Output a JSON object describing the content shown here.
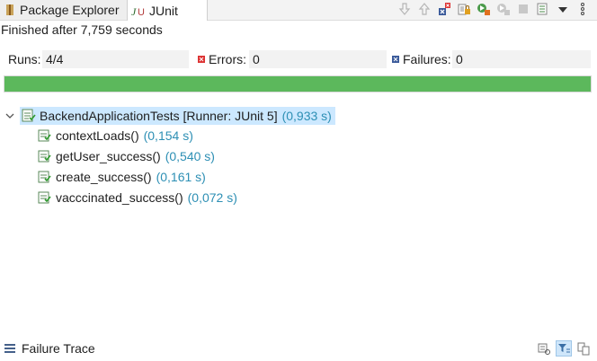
{
  "tabs": {
    "package_explorer": "Package Explorer",
    "junit": "JUnit"
  },
  "toolbar_icons": [
    "next-failure-icon",
    "previous-failure-icon",
    "show-failures-only-icon",
    "scroll-lock-icon",
    "rerun-test-icon",
    "rerun-failed-first-icon",
    "stop-icon",
    "test-run-history-icon",
    "view-menu-icon",
    "more-options-icon"
  ],
  "status": "Finished after 7,759 seconds",
  "counters": {
    "runs_label": "Runs:",
    "runs_value": "4/4",
    "errors_label": "Errors:",
    "errors_value": "0",
    "failures_label": "Failures:",
    "failures_value": "0"
  },
  "progress": {
    "fraction": 1.0,
    "color": "#5cb85c"
  },
  "tree": {
    "root": {
      "name": "BackendApplicationTests [Runner: JUnit 5]",
      "time": "(0,933 s)"
    },
    "tests": [
      {
        "name": "contextLoads()",
        "time": "(0,154 s)"
      },
      {
        "name": "getUser_success()",
        "time": "(0,540 s)"
      },
      {
        "name": "create_success()",
        "time": "(0,161 s)"
      },
      {
        "name": "vacccinated_success()",
        "time": "(0,072 s)"
      }
    ]
  },
  "footer": {
    "title": "Failure Trace"
  },
  "colors": {
    "time": "#2d8fb4",
    "selection": "#cce8ff",
    "progress": "#5cb85c"
  }
}
